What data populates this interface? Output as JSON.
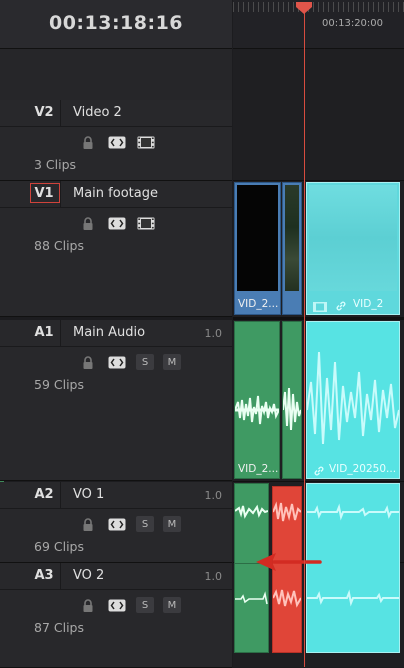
{
  "timecode": "00:13:18:16",
  "ruler": {
    "time_label": "00:13:20:00"
  },
  "colors": {
    "video_track_strip": "#3a6fb0",
    "audio_track_strip": "#3f8a5a",
    "video_clip": "#4a7db4",
    "audio_clip": "#3f9a63",
    "selected_clip": "#57e0e0",
    "red_clip": "#e04538",
    "playhead": "#d74c3f"
  },
  "tracks": [
    {
      "id": "V2",
      "name": "Video 2",
      "clips": "3 Clips",
      "type": "video",
      "active": false
    },
    {
      "id": "V1",
      "name": "Main footage",
      "clips": "88 Clips",
      "type": "video",
      "active": true
    },
    {
      "id": "A1",
      "name": "Main Audio",
      "volume": "1.0",
      "clips": "59 Clips",
      "type": "audio"
    },
    {
      "id": "A2",
      "name": "VO 1",
      "volume": "1.0",
      "clips": "69 Clips",
      "type": "audio"
    },
    {
      "id": "A3",
      "name": "VO 2",
      "volume": "1.0",
      "clips": "87 Clips",
      "type": "audio"
    }
  ],
  "audio_buttons": {
    "solo": "S",
    "mute": "M"
  },
  "clip_labels": {
    "v1_clip_a": "VID_2...",
    "v1_clip_sel": "VID_2",
    "a1_clip_a": "VID_2...",
    "a1_clip_sel": "VID_20250..."
  },
  "icons": {
    "lock": "lock-icon",
    "auto_select": "auto-select-icon",
    "film": "film-strip-icon",
    "link": "link-icon",
    "arrow": "red-arrow-pointer"
  }
}
